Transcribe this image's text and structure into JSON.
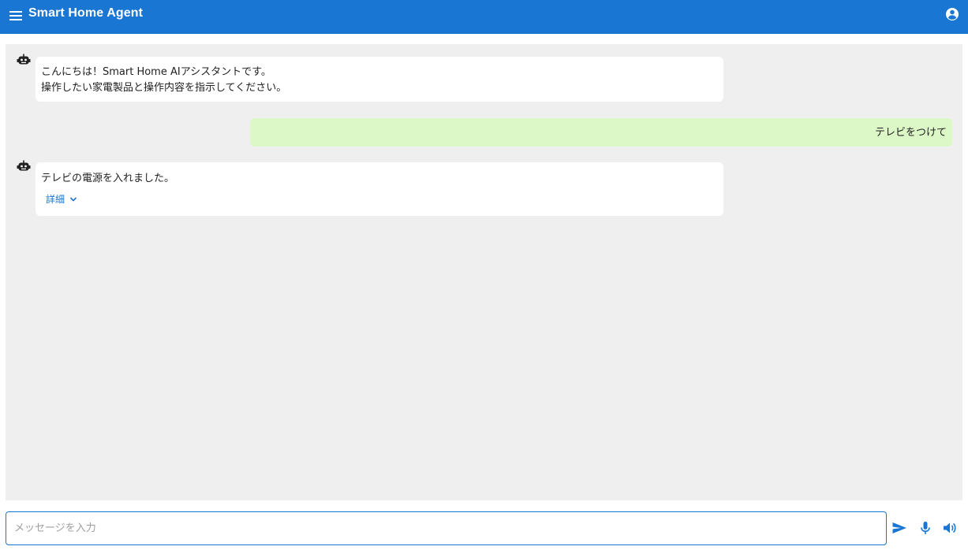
{
  "app": {
    "title": "Smart Home Agent"
  },
  "icons": {
    "menu": "menu-icon",
    "account": "account-circle-icon",
    "bot": "robot-icon",
    "expand": "chevron-down-icon",
    "send": "send-icon",
    "mic": "microphone-icon",
    "volume": "volume-icon"
  },
  "colors": {
    "primary": "#1976d2",
    "chat_bg": "#efefef",
    "user_bubble": "#dcf8c6",
    "bot_bubble": "#ffffff"
  },
  "messages": [
    {
      "sender": "bot",
      "lines": [
        "こんにちは！Smart Home AIアシスタントです。",
        "操作したい家電製品と操作内容を指示してください。"
      ]
    },
    {
      "sender": "user",
      "text": "テレビをつけて"
    },
    {
      "sender": "bot",
      "text": "テレビの電源を入れました。",
      "details_label": "詳細"
    }
  ],
  "composer": {
    "placeholder": "メッセージを入力",
    "value": ""
  }
}
